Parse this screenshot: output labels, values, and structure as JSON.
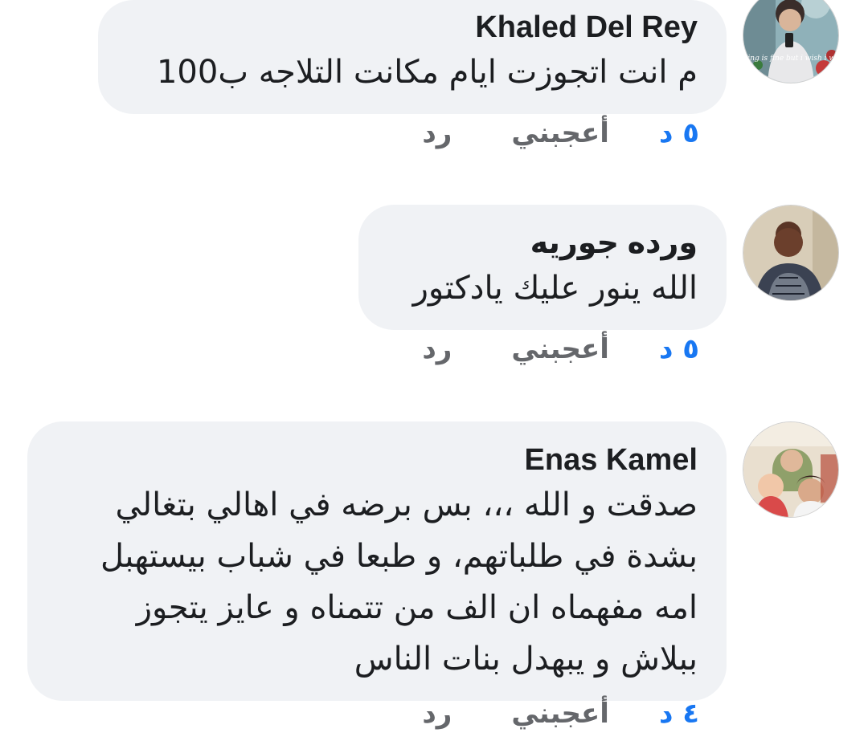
{
  "comments": [
    {
      "author": "Khaled Del Rey",
      "text_lines": [
        "م انت اتجوزت ايام مكانت التلاجه ب100"
      ],
      "time": "٥ د",
      "like_label": "أعجبني",
      "reply_label": "رد",
      "avatar_caption": "everything is fine but i wish i was dead"
    },
    {
      "author": "ورده جوريه",
      "text_lines": [
        "الله ينور عليك يادكتور"
      ],
      "time": "٥ د",
      "like_label": "أعجبني",
      "reply_label": "رد"
    },
    {
      "author": "Enas Kamel",
      "text_lines": [
        "صدقت و الله ،،، بس برضه في اهالي بتغالي",
        "بشدة في طلباتهم، و طبعا في شباب بيستهبل",
        "امه مفهماه ان الف من تتمناه و عايز يتجوز",
        "ببلاش و يبهدل بنات الناس"
      ],
      "time": "٤ د",
      "like_label": "أعجبني",
      "reply_label": "رد"
    }
  ],
  "colors": {
    "bubble": "#f0f2f5",
    "time_link": "#1877f2",
    "action_text": "#65676b",
    "name_text": "#1c1e21"
  }
}
